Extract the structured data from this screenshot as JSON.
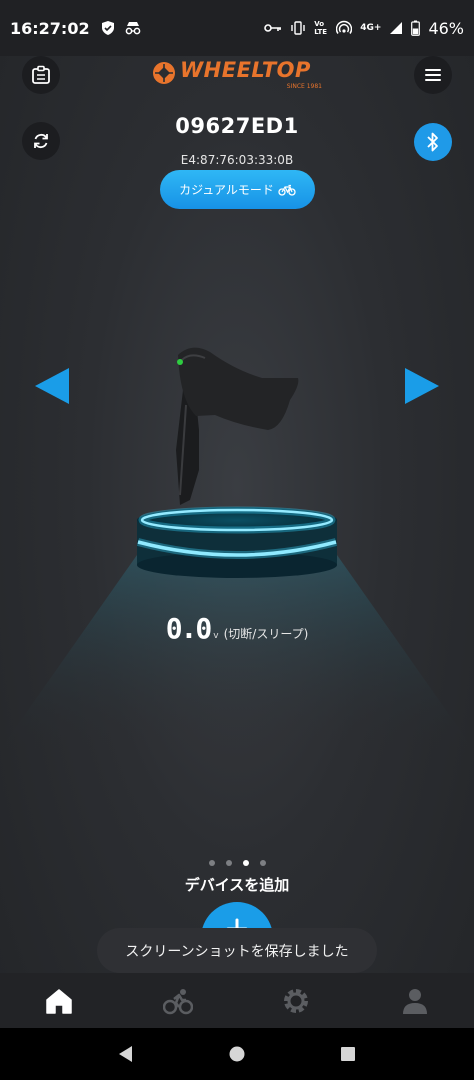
{
  "status_bar": {
    "time": "16:27:02",
    "network": "4G+",
    "volte": "Vo LTE",
    "battery": "46%"
  },
  "header": {
    "brand": "WHEELTOP",
    "brand_since": "SINCE 1981",
    "brand_color": "#e8742c"
  },
  "device": {
    "name": "09627ED1",
    "mac": "E4:87:76:03:33:0B",
    "mode_label": "カジュアルモード",
    "mode_icon": "bicycle-icon"
  },
  "voltage": {
    "value": "0.0",
    "unit": "v",
    "status": "(切断/スリープ)"
  },
  "pager": {
    "count": 4,
    "active_index": 2
  },
  "add_device": {
    "label": "デバイスを追加"
  },
  "toast": {
    "message": "スクリーンショットを保存しました"
  },
  "bottom_nav": {
    "items": [
      "home-icon",
      "cycling-icon",
      "settings-icon",
      "profile-icon"
    ],
    "active": "home-icon"
  },
  "colors": {
    "accent": "#1a9de8",
    "background": "#2b2d30"
  }
}
